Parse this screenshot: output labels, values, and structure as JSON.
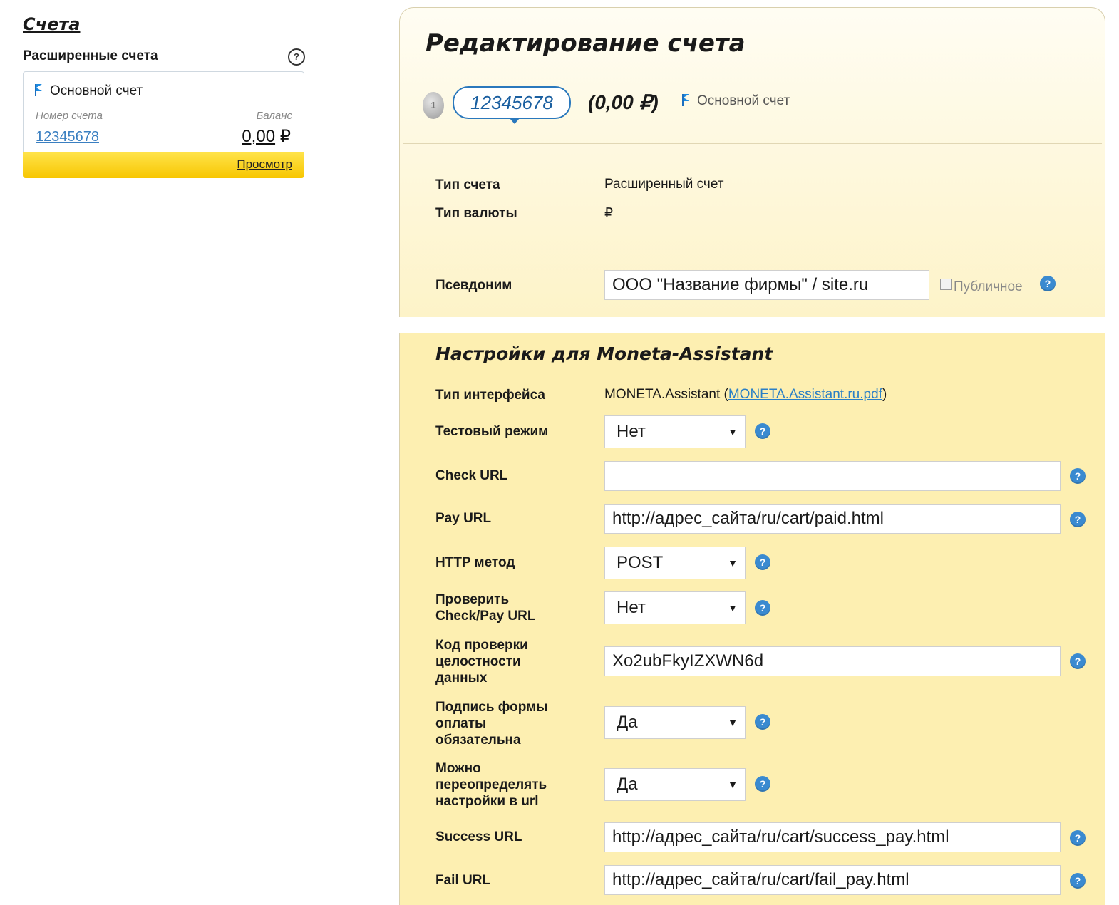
{
  "sidebar": {
    "title": "Счета",
    "section_label": "Расширенные счета",
    "help": "?",
    "card": {
      "name": "Основной счет",
      "number_label": "Номер счета",
      "balance_label": "Баланс",
      "number": "12345678",
      "balance_amount": "0,00",
      "currency": "₽",
      "view_link": "Просмотр"
    }
  },
  "edit": {
    "title": "Редактирование счета",
    "coin_label": "1",
    "account_number": "12345678",
    "amount": "(0,00 ₽)",
    "account_label": "Основной счет",
    "type_label": "Тип счета",
    "type_value": "Расширенный счет",
    "currency_label": "Тип валюты",
    "currency_value": "₽",
    "alias_label": "Псевдоним",
    "alias_value": "ООО \"Название фирмы\" / site.ru",
    "public_label": "Публичное",
    "help": "?"
  },
  "settings": {
    "title": "Настройки для Moneta-Assistant",
    "interface_label": "Тип интерфейса",
    "interface_value": "MONETA.Assistant (",
    "interface_link": "MONETA.Assistant.ru.pdf",
    "interface_close": ")",
    "test_mode_label": "Тестовый режим",
    "test_mode_value": "Нет",
    "check_url_label": "Check URL",
    "check_url_value": "",
    "pay_url_label": "Pay URL",
    "pay_url_value": "http://адрес_сайта/ru/cart/paid.html",
    "http_method_label": "HTTP метод",
    "http_method_value": "POST",
    "verify_urls_label_1": "Проверить",
    "verify_urls_label_2": "Check/Pay URL",
    "verify_urls_value": "Нет",
    "integrity_label_1": "Код проверки",
    "integrity_label_2": "целостности",
    "integrity_label_3": "данных",
    "integrity_value": "Xo2ubFkyIZXWN6d",
    "signature_label_1": "Подпись формы",
    "signature_label_2": "оплаты",
    "signature_label_3": "обязательна",
    "signature_value": "Да",
    "override_label_1": "Можно",
    "override_label_2": "переопределять",
    "override_label_3": "настройки в url",
    "override_value": "Да",
    "success_url_label": "Success URL",
    "success_url_value": "http://адрес_сайта/ru/cart/success_pay.html",
    "fail_url_label": "Fail URL",
    "fail_url_value": "http://адрес_сайта/ru/cart/fail_pay.html",
    "help": "?",
    "arrow": "▼"
  }
}
